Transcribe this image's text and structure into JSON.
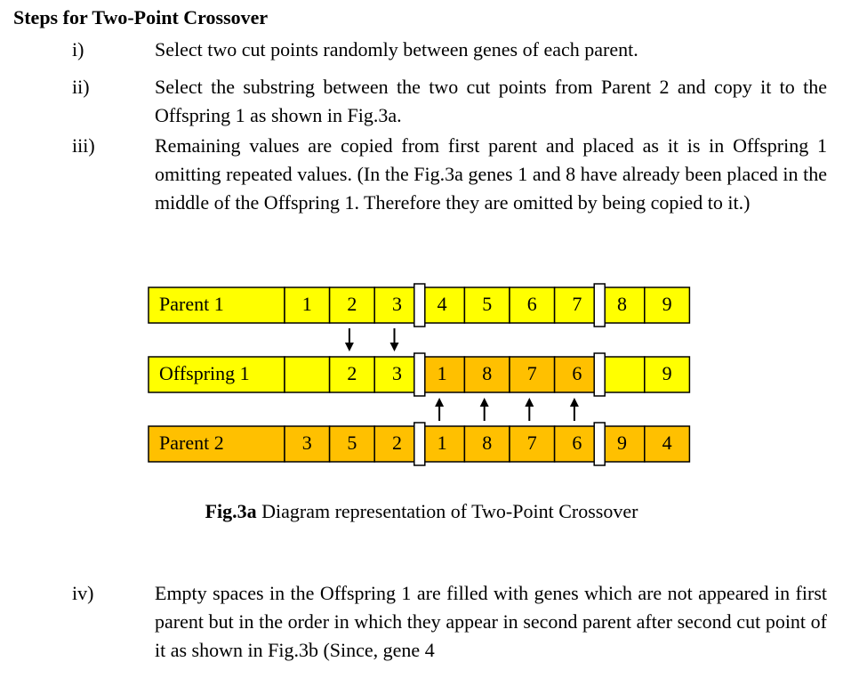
{
  "heading": "Steps for Two-Point Crossover",
  "steps": [
    {
      "num": "i)",
      "text": "Select two cut points randomly between genes of each parent."
    },
    {
      "num": "ii)",
      "text": "Select the substring between the two cut points from Parent 2 and copy it to the Offspring 1 as shown in Fig.3a."
    },
    {
      "num": "iii)",
      "text": "Remaining values are copied from first parent and placed as it is in Offspring 1 omitting repeated values. (In the Fig.3a genes 1 and 8 have already been placed in the middle of the Offspring 1.  Therefore they are omitted by being copied to it.)"
    },
    {
      "num": "iv)",
      "text": "Empty spaces in the Offspring 1 are filled with genes which are not appeared in first parent but in the order in which they appear in second parent after second cut point of it as shown in Fig.3b (Since, gene 4"
    }
  ],
  "diagram": {
    "colors": {
      "yellow": "#ffff00",
      "orange": "#ffc000",
      "border": "#000000"
    },
    "rows": [
      {
        "label": "Parent 1",
        "genes": [
          "1",
          "2",
          "3",
          "4",
          "5",
          "6",
          "7",
          "8",
          "9"
        ],
        "fill": [
          "yellow",
          "yellow",
          "yellow",
          "yellow",
          "yellow",
          "yellow",
          "yellow",
          "yellow",
          "yellow"
        ],
        "label_fill": "yellow"
      },
      {
        "label": "Offspring 1",
        "genes": [
          "",
          "2",
          "3",
          "1",
          "8",
          "7",
          "6",
          "",
          "9"
        ],
        "fill": [
          "yellow",
          "yellow",
          "yellow",
          "orange",
          "orange",
          "orange",
          "orange",
          "yellow",
          "yellow"
        ],
        "label_fill": "yellow"
      },
      {
        "label": "Parent 2",
        "genes": [
          "3",
          "5",
          "2",
          "1",
          "8",
          "7",
          "6",
          "9",
          "4"
        ],
        "fill": [
          "orange",
          "orange",
          "orange",
          "orange",
          "orange",
          "orange",
          "orange",
          "orange",
          "orange"
        ],
        "label_fill": "orange"
      }
    ],
    "cut_points": [
      3,
      7
    ],
    "arrows_down": [
      1,
      2
    ],
    "arrows_up": [
      3,
      4,
      5,
      6
    ]
  },
  "caption": {
    "bold": "Fig.3a",
    "text": " Diagram representation of Two-Point Crossover"
  }
}
